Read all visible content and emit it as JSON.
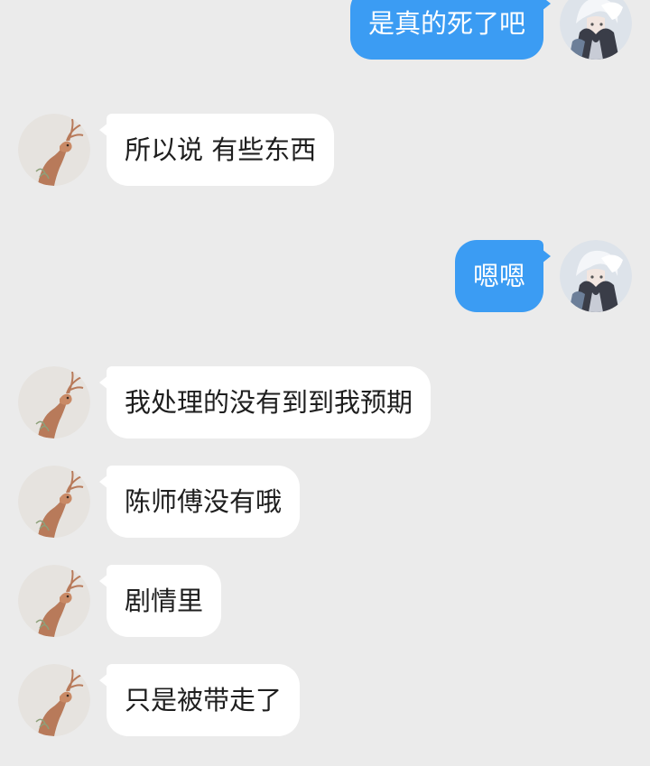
{
  "colors": {
    "background": "#ebebeb",
    "outgoing_bubble": "#3b9cf3",
    "incoming_bubble": "#ffffff",
    "incoming_text": "#1e1e1e",
    "outgoing_text": "#ffffff"
  },
  "avatars": {
    "self": "anime-character-avatar",
    "other": "deer-avatar"
  },
  "messages": [
    {
      "direction": "out",
      "text": "是真的死了吧"
    },
    {
      "direction": "in",
      "text": "所以说 有些东西"
    },
    {
      "direction": "out",
      "text": "嗯嗯"
    },
    {
      "direction": "in",
      "text": "我处理的没有到到我预期"
    },
    {
      "direction": "in",
      "text": "陈师傅没有哦"
    },
    {
      "direction": "in",
      "text": "剧情里"
    },
    {
      "direction": "in",
      "text": "只是被带走了"
    }
  ]
}
